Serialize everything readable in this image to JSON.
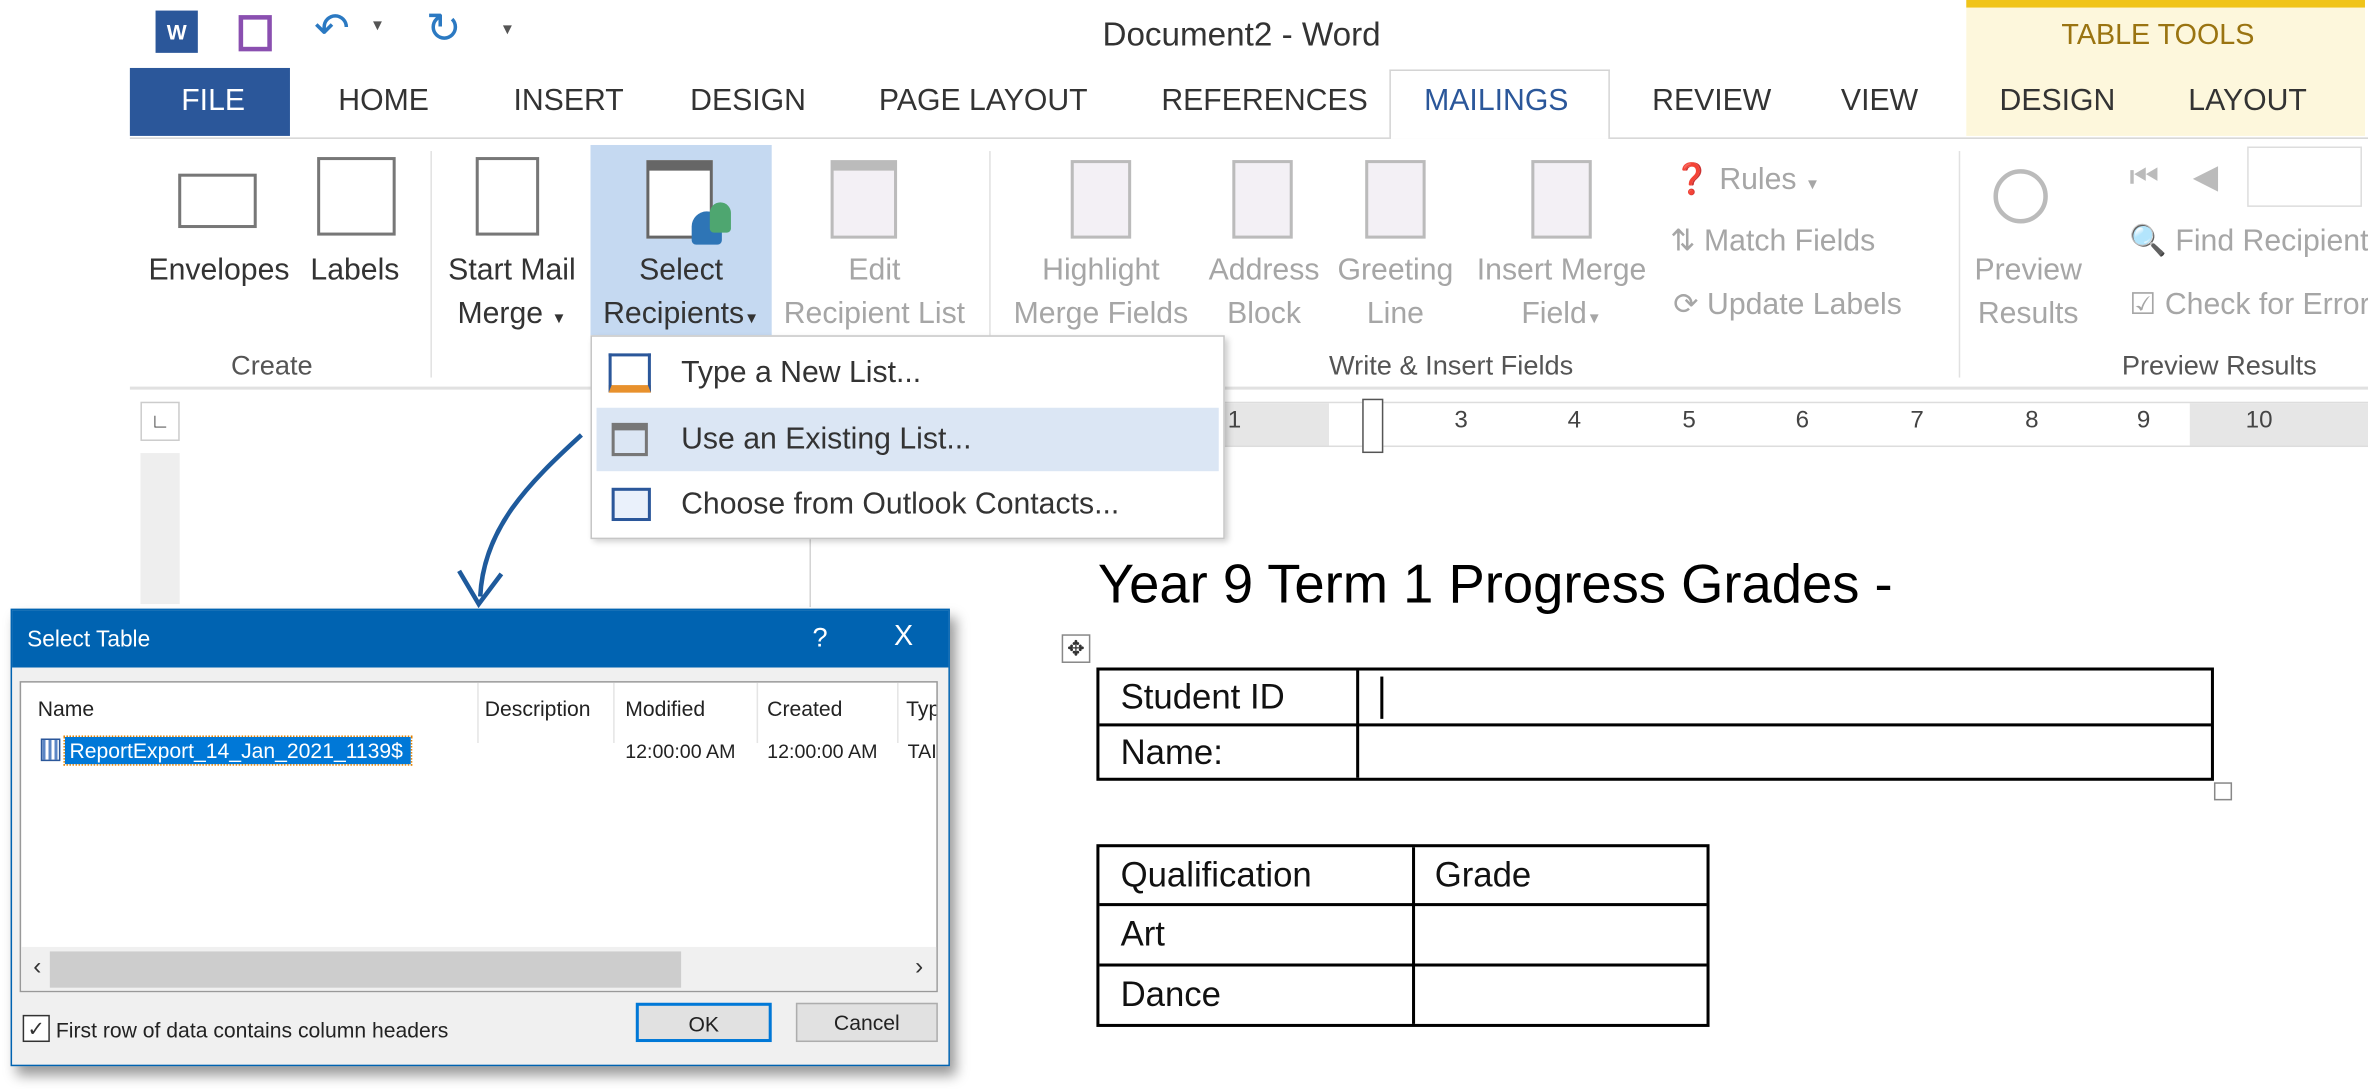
{
  "window": {
    "title": "Document2 - Word",
    "contextual_title": "TABLE TOOLS"
  },
  "colors": {
    "file_tab": "#2b579a",
    "active_tab_text": "#2b579a",
    "select_recipients_bg": "#c5d9f1",
    "dialog_title": "#0063b1",
    "selection": "#0078d7",
    "table_tools": "#fdf7dc"
  },
  "tabs": [
    "FILE",
    "HOME",
    "INSERT",
    "DESIGN",
    "PAGE LAYOUT",
    "REFERENCES",
    "MAILINGS",
    "REVIEW",
    "VIEW",
    "DESIGN",
    "LAYOUT"
  ],
  "active_tab": "MAILINGS",
  "ribbon": {
    "create": {
      "label": "Create",
      "envelopes": "Envelopes",
      "labels": "Labels"
    },
    "start_merge": {
      "line1": "Start Mail",
      "line2": "Merge"
    },
    "select_recipients": {
      "line1": "Select",
      "line2": "Recipients"
    },
    "edit_list": {
      "line1": "Edit",
      "line2": "Recipient List"
    },
    "write_insert": {
      "label": "Write & Insert Fields",
      "highlight": [
        "Highlight",
        "Merge Fields"
      ],
      "address": [
        "Address",
        "Block"
      ],
      "greeting": [
        "Greeting",
        "Line"
      ],
      "insert_field": [
        "Insert Merge",
        "Field"
      ],
      "rules": "Rules",
      "match": "Match Fields",
      "update": "Update Labels"
    },
    "preview": {
      "label": "Preview Results",
      "preview_btn": [
        "Preview",
        "Results"
      ],
      "find": "Find Recipient",
      "check": "Check for Errors"
    }
  },
  "dropdown": {
    "items": [
      "Type a New List...",
      "Use an Existing List...",
      "Choose from Outlook Contacts..."
    ],
    "highlighted": 1
  },
  "ruler": {
    "numbers": [
      "1",
      "3",
      "4",
      "5",
      "6",
      "7",
      "8",
      "9",
      "10"
    ]
  },
  "dialog": {
    "title": "Select Table",
    "help": "?",
    "close": "X",
    "columns": [
      "Name",
      "Description",
      "Modified",
      "Created",
      "Typ"
    ],
    "rows": [
      {
        "name": "ReportExport_14_Jan_2021_1139$",
        "description": "",
        "modified": "12:00:00 AM",
        "created": "12:00:00 AM",
        "type": "TAI"
      }
    ],
    "checkbox_label": "First row of data contains column headers",
    "checkbox_checked": true,
    "ok": "OK",
    "cancel": "Cancel"
  },
  "document": {
    "heading": "Year 9 Term 1 Progress Grades -",
    "table1": [
      [
        "Student ID",
        ""
      ],
      [
        "Name:",
        ""
      ]
    ],
    "table2": [
      [
        "Qualification",
        "Grade"
      ],
      [
        "Art",
        ""
      ],
      [
        "Dance",
        ""
      ]
    ]
  }
}
